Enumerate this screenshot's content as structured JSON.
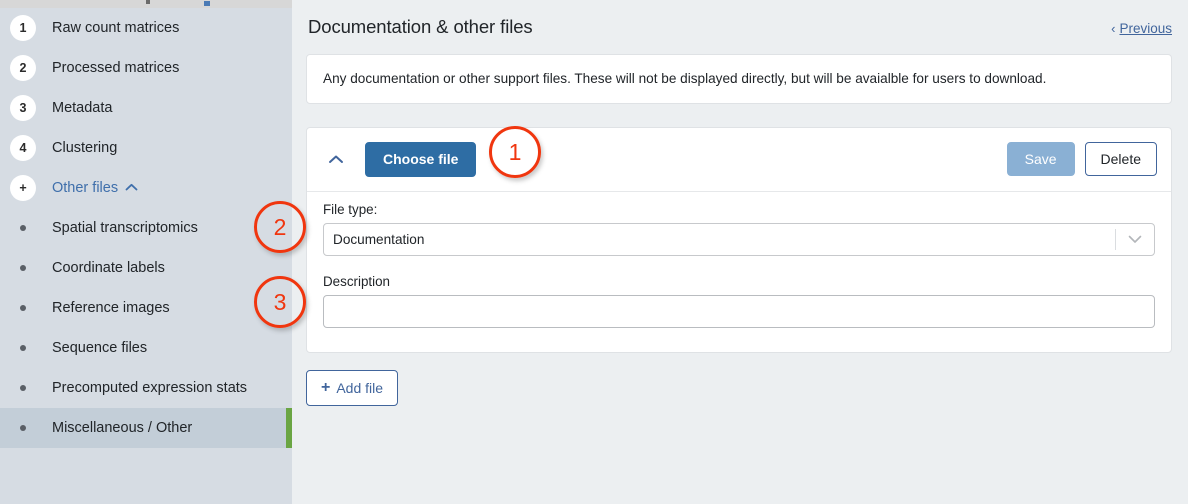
{
  "sidebar": {
    "items": [
      {
        "badge": "1",
        "badge_type": "number",
        "label": "Raw count matrices",
        "active": false,
        "link": false
      },
      {
        "badge": "2",
        "badge_type": "number",
        "label": "Processed matrices",
        "active": false,
        "link": false
      },
      {
        "badge": "3",
        "badge_type": "number",
        "label": "Metadata",
        "active": false,
        "link": false
      },
      {
        "badge": "4",
        "badge_type": "number",
        "label": "Clustering",
        "active": false,
        "link": false
      },
      {
        "badge": "+",
        "badge_type": "number",
        "label": "Other files",
        "active": false,
        "link": true,
        "chevron": "chevron-up-icon"
      },
      {
        "badge": "",
        "badge_type": "dot",
        "label": "Spatial transcriptomics",
        "active": false,
        "link": false
      },
      {
        "badge": "",
        "badge_type": "dot",
        "label": "Coordinate labels",
        "active": false,
        "link": false
      },
      {
        "badge": "",
        "badge_type": "dot",
        "label": "Reference images",
        "active": false,
        "link": false
      },
      {
        "badge": "",
        "badge_type": "dot",
        "label": "Sequence files",
        "active": false,
        "link": false
      },
      {
        "badge": "",
        "badge_type": "dot",
        "label": "Precomputed expression stats",
        "active": false,
        "link": false
      },
      {
        "badge": "",
        "badge_type": "dot",
        "label": "Miscellaneous / Other",
        "active": true,
        "link": false
      }
    ]
  },
  "header": {
    "title": "Documentation & other files",
    "previous_label": "Previous",
    "previous_chevron": "‹"
  },
  "info": {
    "text": "Any documentation or other support files. These will not be displayed directly, but will be avaialble for users to download."
  },
  "file_card": {
    "collapse_icon": "chevron-up-icon",
    "choose_file_label": "Choose file",
    "save_label": "Save",
    "delete_label": "Delete",
    "file_type_label": "File type:",
    "file_type_value": "Documentation",
    "file_type_options": [
      "Documentation"
    ],
    "description_label": "Description",
    "description_value": "",
    "description_placeholder": ""
  },
  "footer": {
    "add_file_label": "Add file",
    "add_file_plus": "+"
  },
  "annotations": [
    {
      "number": "1"
    },
    {
      "number": "2"
    },
    {
      "number": "3"
    }
  ],
  "colors": {
    "accent_blue": "#2e6da4",
    "link_blue": "#41659c",
    "annotation_red": "#f0360f",
    "active_green": "#6aa543",
    "sidebar_bg": "#d6dce3",
    "page_bg": "#eceff1"
  }
}
